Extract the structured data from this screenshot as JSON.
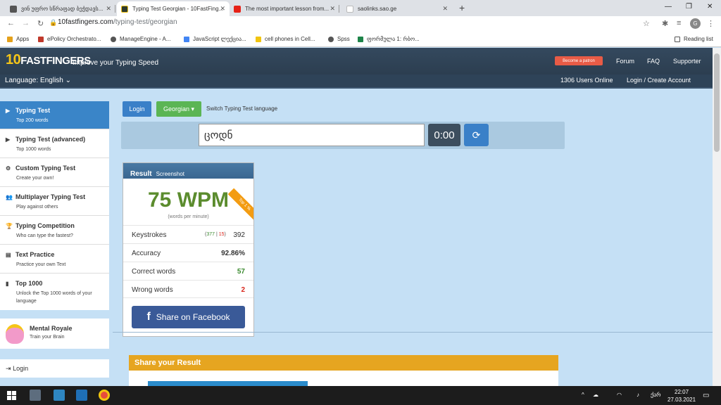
{
  "browser": {
    "tabs": [
      {
        "title": "ვინ უფრო სწრაფად ბეჭდავს...",
        "color": "#555"
      },
      {
        "title": "Typing Test Georgian - 10FastFing...",
        "color": "#2e3b2e"
      },
      {
        "title": "The most important lesson from...",
        "color": "#e62117"
      },
      {
        "title": "saolinks.sao.ge",
        "color": "#fff"
      }
    ],
    "url_host": "10fastfingers.com",
    "url_path": "/typing-test/georgian",
    "profile_initial": "G",
    "bookmarks": [
      "Apps",
      "ePolicy Orchestrato...",
      "ManageEngine - A...",
      "JavaScript ლექცია...",
      "cell phones in Cell...",
      "Spss",
      "ფორმულა 1: რბო..."
    ],
    "reading_list": "Reading list"
  },
  "site": {
    "logo": "10FASTFINGERS",
    "logo_one": "10",
    "logo_rest": "FASTFINGERS",
    "tagline": "Improve your Typing Speed",
    "patron": "Become a patron",
    "forum": "Forum",
    "faq": "FAQ",
    "supporter": "Supporter",
    "language": "Language: English",
    "users_online": "1306 Users Online",
    "login_create": "Login / Create Account"
  },
  "sidebar": {
    "items": [
      {
        "title": "Typing Test",
        "sub": "Top 200 words",
        "icon": "▶"
      },
      {
        "title": "Typing Test (advanced)",
        "sub": "Top 1000 words",
        "icon": "▶"
      },
      {
        "title": "Custom Typing Test",
        "sub": "Create your own!",
        "icon": "⚙"
      },
      {
        "title": "Multiplayer Typing Test",
        "sub": "Play against others",
        "icon": "👥"
      },
      {
        "title": "Typing Competition",
        "sub": "Who can type the fastest?",
        "icon": "🏆"
      },
      {
        "title": "Text Practice",
        "sub": "Practice your own Text",
        "icon": "▤"
      },
      {
        "title": "Top 1000",
        "sub": "Unlock the Top 1000 words of your language",
        "icon": "▮"
      }
    ],
    "mental_title": "Mental Royale",
    "mental_sub": "Train your Brain",
    "login": "Login"
  },
  "test": {
    "login_btn": "Login",
    "lang_btn": "Georgian ▾",
    "switch_text": "Switch Typing Test language",
    "input_value": "ცოდნ",
    "timer": "0:00"
  },
  "result": {
    "title": "Result",
    "screenshot": "Screenshot",
    "ribbon": "Top 1 %",
    "wpm": "75 WPM",
    "wpm_sub": "(words per minute)",
    "keystrokes_label": "Keystrokes",
    "keystrokes_correct": "377",
    "keystrokes_wrong": "15",
    "keystrokes_total": "392",
    "accuracy_label": "Accuracy",
    "accuracy": "92.86%",
    "correct_label": "Correct words",
    "correct": "57",
    "wrong_label": "Wrong words",
    "wrong": "2",
    "facebook": "Share on Facebook"
  },
  "share": {
    "title": "Share your Result"
  },
  "taskbar": {
    "time": "22:07",
    "date": "27.03.2021",
    "lang": "ქარ"
  }
}
